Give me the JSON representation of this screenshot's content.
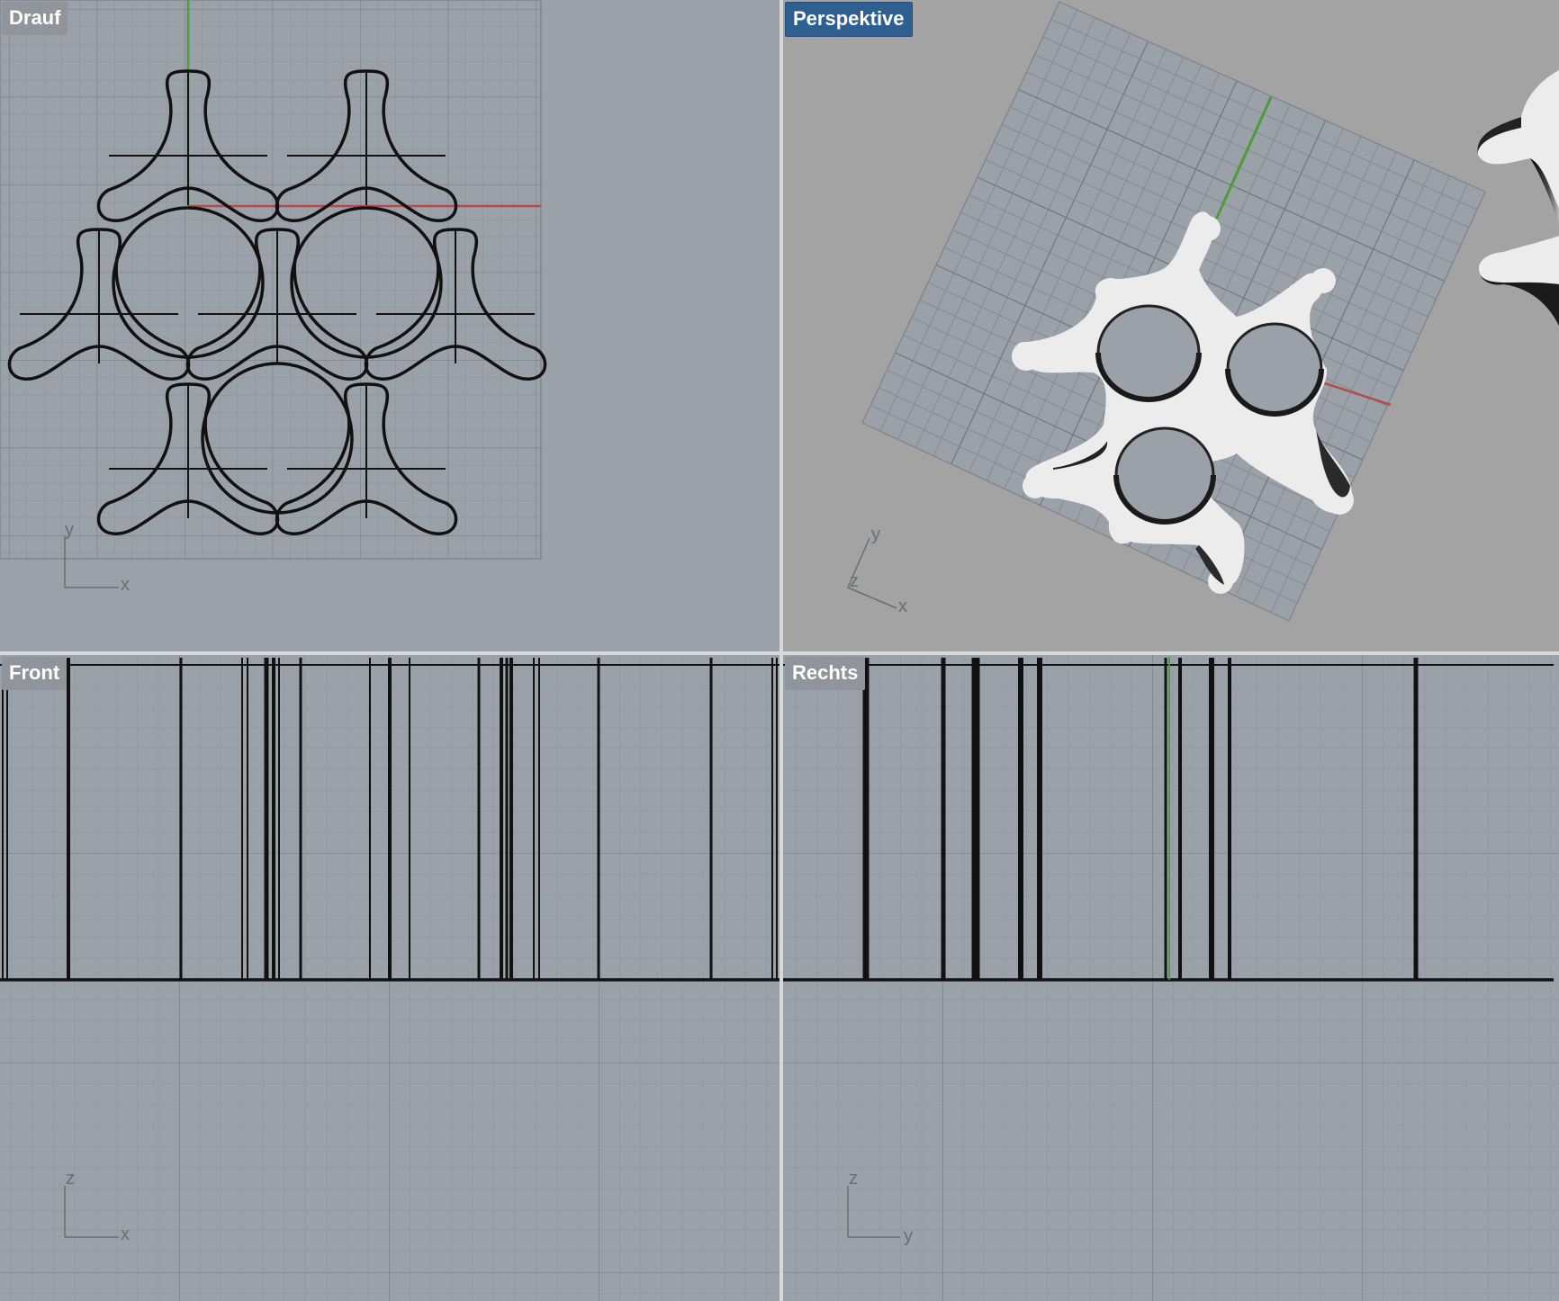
{
  "viewports": {
    "top": {
      "title": "Drauf",
      "active": false,
      "axis_h": "x",
      "axis_v": "y"
    },
    "persp": {
      "title": "Perspektive",
      "active": true,
      "axis_x": "x",
      "axis_y": "y",
      "axis_z": "z"
    },
    "front": {
      "title": "Front",
      "active": false,
      "axis_h": "x",
      "axis_v": "z"
    },
    "right": {
      "title": "Rechts",
      "active": false,
      "axis_h": "y",
      "axis_v": "z"
    }
  },
  "colors": {
    "viewport_bg": "#9aa1a9",
    "persp_bg": "#a3a3a3",
    "grid_minor": "#8c939b",
    "grid_major": "#7f858c",
    "x_axis": "#b54a4a",
    "y_axis": "#4f9a3a",
    "curve": "#111111",
    "surface": "#ececec",
    "active_label": "#2f5f91"
  }
}
